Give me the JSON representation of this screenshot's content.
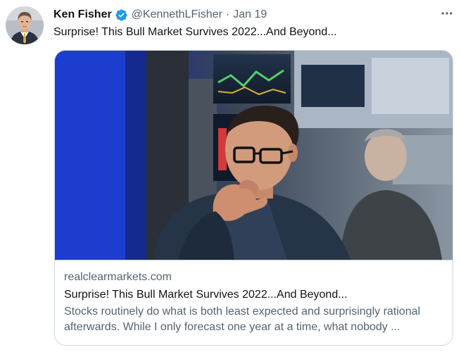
{
  "tweet": {
    "author": {
      "name": "Ken Fisher",
      "handle": "@KennethLFisher",
      "verified": true
    },
    "separator": "·",
    "timestamp": "Jan 19",
    "text": "Surprise! This Bull Market Survives 2022...And Beyond...",
    "more_icon": "more-horizontal-icon"
  },
  "card": {
    "domain": "realclearmarkets.com",
    "title": "Surprise! This Bull Market Survives 2022...And Beyond...",
    "description": "Stocks routinely do what is both least expected and surprisingly rational afterwards. While I only forecast one year at a time, what nobody ..."
  },
  "colors": {
    "text_primary": "#0f1419",
    "text_secondary": "#536471",
    "verified_blue": "#1d9bf0",
    "border": "#cfd9de"
  }
}
